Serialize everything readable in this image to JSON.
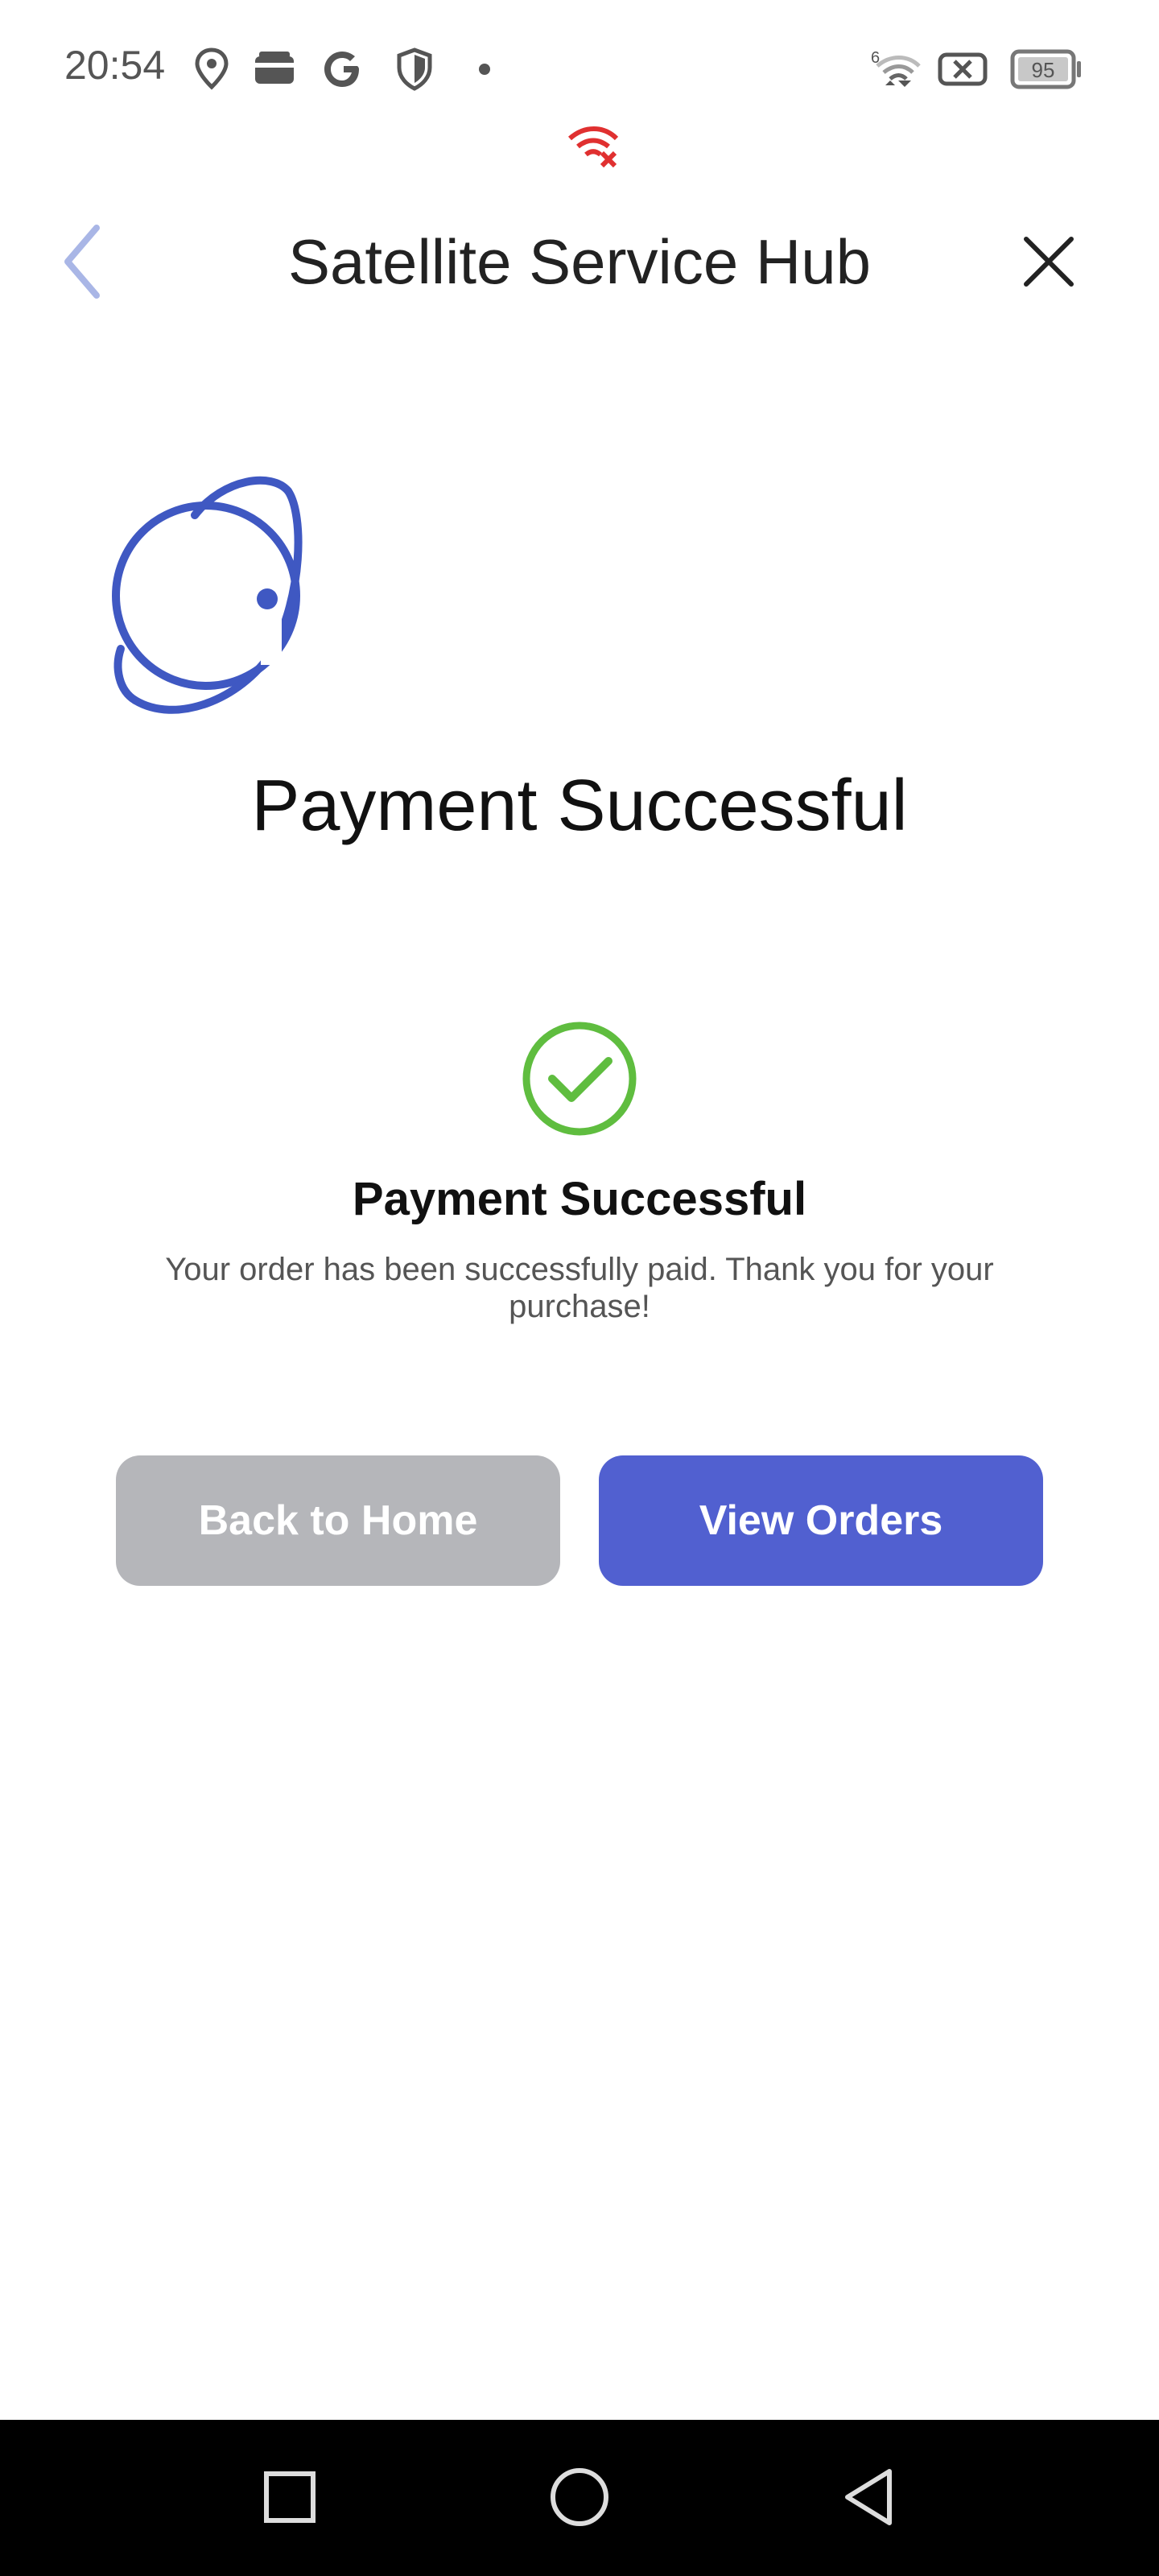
{
  "status_bar": {
    "time": "20:54",
    "battery_level": "95",
    "signal_label": "6",
    "icons": [
      "location-icon",
      "wallet-icon",
      "google-icon",
      "shield-icon",
      "dot-icon",
      "wifi-icon",
      "sim-blocked-icon",
      "battery-icon",
      "wifi-alert-icon"
    ]
  },
  "header": {
    "title": "Satellite Service Hub",
    "back_icon": "chevron-left-icon",
    "close_icon": "close-icon"
  },
  "logo": {
    "icon": "planet-logo-icon",
    "color": "#3f58c2"
  },
  "page": {
    "heading": "Payment Successful"
  },
  "result": {
    "icon": "check-circle-icon",
    "icon_color": "#5fbd3f",
    "title": "Payment Successful",
    "message": "Your order has been successfully paid. Thank you for your purchase!"
  },
  "actions": {
    "back_home_label": "Back to Home",
    "back_home_color": "#b5b6ba",
    "view_orders_label": "View Orders",
    "view_orders_color": "#5160d0"
  },
  "nav_bar": {
    "icons": [
      "recent-apps-icon",
      "home-icon",
      "back-icon"
    ]
  }
}
